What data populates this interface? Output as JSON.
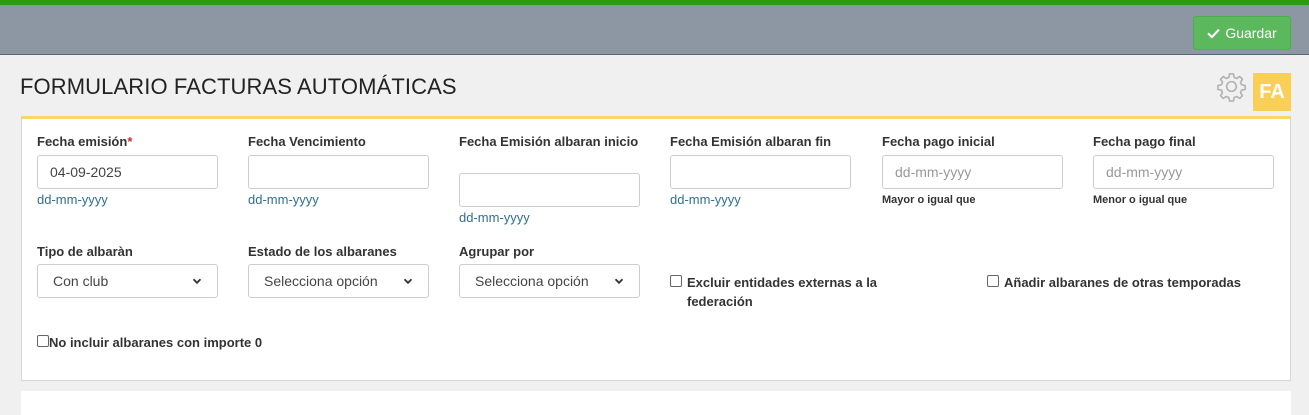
{
  "toolbar": {
    "save_label": "Guardar"
  },
  "page": {
    "title": "FORMULARIO FACTURAS AUTOMÁTICAS",
    "badge": "FA"
  },
  "fields": {
    "fecha_emision": {
      "label": "Fecha emisión",
      "required_mark": "*",
      "value": "04-09-2025",
      "hint": "dd-mm-yyyy"
    },
    "fecha_vencimiento": {
      "label": "Fecha Vencimiento",
      "value": "",
      "hint": "dd-mm-yyyy"
    },
    "fecha_albaran_inicio": {
      "label": "Fecha Emisión albaran inicio",
      "value": "",
      "hint": "dd-mm-yyyy"
    },
    "fecha_albaran_fin": {
      "label": "Fecha Emisión albaran fin",
      "value": "",
      "hint": "dd-mm-yyyy"
    },
    "fecha_pago_inicial": {
      "label": "Fecha pago inicial",
      "placeholder": "dd-mm-yyyy",
      "note": "Mayor o igual que"
    },
    "fecha_pago_final": {
      "label": "Fecha pago final",
      "placeholder": "dd-mm-yyyy",
      "note": "Menor o igual que"
    },
    "tipo_albaran": {
      "label": "Tipo de albaràn",
      "selected": "Con club"
    },
    "estado_albaranes": {
      "label": "Estado de los albaranes",
      "selected": "Selecciona opción"
    },
    "agrupar_por": {
      "label": "Agrupar por",
      "selected": "Selecciona opción"
    }
  },
  "checkboxes": {
    "excluir_externas": {
      "label": "Excluir entidades externas a la federación",
      "checked": false
    },
    "otras_temporadas": {
      "label": "Añadir albaranes de otras temporadas",
      "checked": false
    },
    "no_importe_cero": {
      "label": "No incluir albaranes con importe 0",
      "checked": false
    }
  },
  "colors": {
    "accent_green": "#5cb85c",
    "badge_yellow": "#f9cf55",
    "hint_blue": "#31708f",
    "required_red": "#c9302c"
  },
  "icons": {
    "save": "check-icon",
    "settings": "gear-icon",
    "select": "chevron-down-icon"
  }
}
